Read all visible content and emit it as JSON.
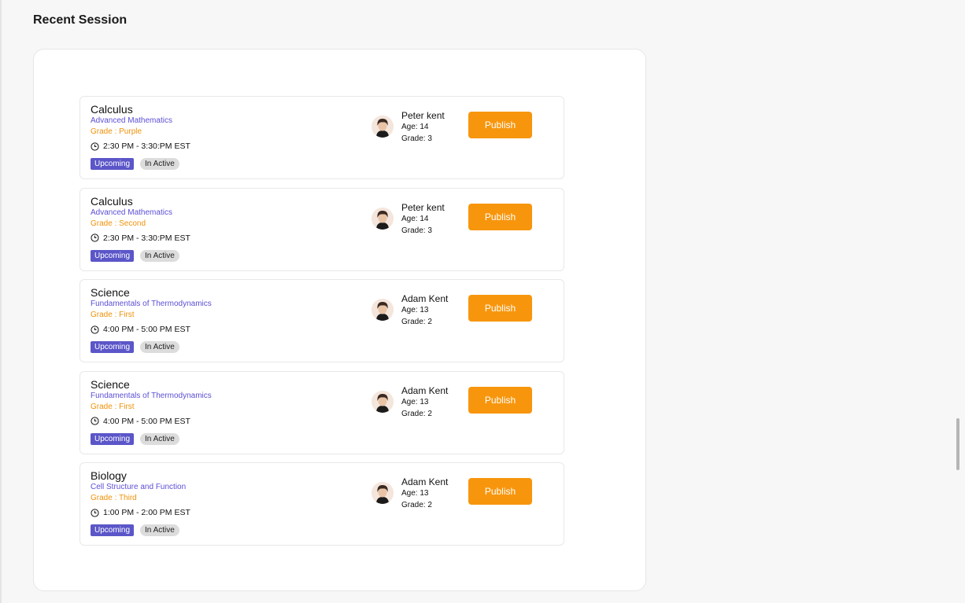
{
  "page": {
    "title": "Recent Session"
  },
  "colors": {
    "accent_purple": "#5b56c8",
    "topic_purple": "#5b4fd6",
    "grade_orange": "#f0920a",
    "publish_orange": "#f7960d",
    "inactive_gray": "#dcdcdc"
  },
  "sessions": [
    {
      "subject": "Calculus",
      "topic": "Advanced  Mathematics",
      "grade": "Grade : Purple",
      "time": "2:30 PM - 3:30:PM EST",
      "status_upcoming": "Upcoming",
      "status_active": "In Active",
      "student": {
        "name": "Peter kent",
        "age": "Age: 14",
        "grade": "Grade: 3"
      },
      "publish_label": "Publish"
    },
    {
      "subject": "Calculus",
      "topic": "Advanced  Mathematics",
      "grade": "Grade : Second",
      "time": "2:30 PM - 3:30:PM EST",
      "status_upcoming": "Upcoming",
      "status_active": "In Active",
      "student": {
        "name": "Peter kent",
        "age": "Age: 14",
        "grade": "Grade: 3"
      },
      "publish_label": "Publish"
    },
    {
      "subject": "Science",
      "topic": "Fundamentals of Thermodynamics",
      "grade": "Grade : First",
      "time": "4:00 PM - 5:00 PM EST",
      "status_upcoming": "Upcoming",
      "status_active": "In Active",
      "student": {
        "name": "Adam Kent",
        "age": "Age: 13",
        "grade": "Grade: 2"
      },
      "publish_label": "Publish"
    },
    {
      "subject": "Science",
      "topic": "Fundamentals of Thermodynamics",
      "grade": "Grade : First",
      "time": "4:00 PM - 5:00 PM EST",
      "status_upcoming": "Upcoming",
      "status_active": "In Active",
      "student": {
        "name": "Adam Kent",
        "age": "Age: 13",
        "grade": "Grade: 2"
      },
      "publish_label": "Publish"
    },
    {
      "subject": "Biology",
      "topic": "Cell Structure and Function",
      "grade": "Grade : Third",
      "time": "1:00 PM - 2:00 PM EST",
      "status_upcoming": "Upcoming",
      "status_active": "In Active",
      "student": {
        "name": "Adam Kent",
        "age": "Age: 13",
        "grade": "Grade: 2"
      },
      "publish_label": "Publish"
    }
  ]
}
